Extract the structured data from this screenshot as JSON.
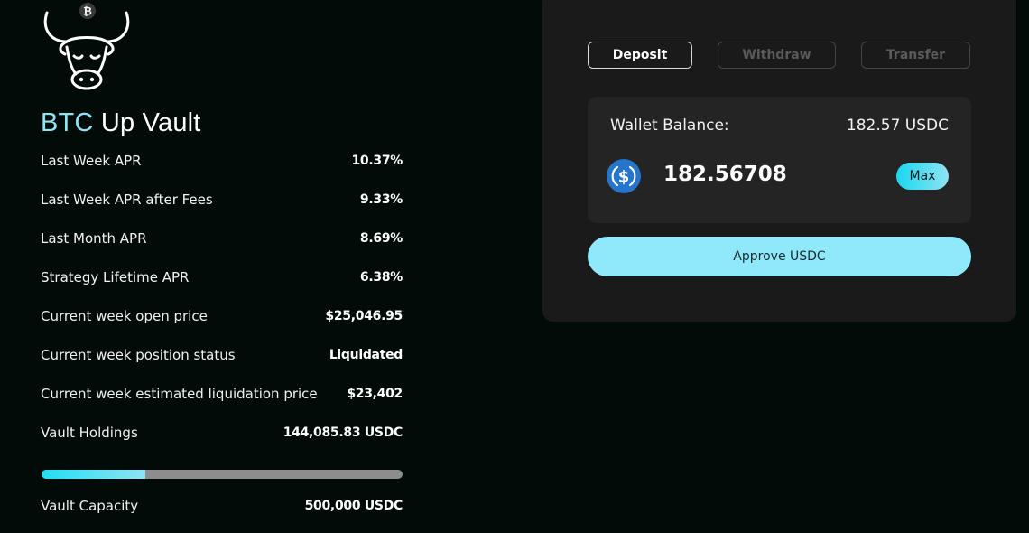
{
  "vault": {
    "title_accent": "BTC",
    "title_rest": "Up Vault",
    "stats": [
      {
        "label": "Last Week APR",
        "value": "10.37%"
      },
      {
        "label": "Last Week APR after Fees",
        "value": "9.33%"
      },
      {
        "label": "Last Month APR",
        "value": "8.69%"
      },
      {
        "label": "Strategy Lifetime APR",
        "value": "6.38%"
      },
      {
        "label": "Current week open price",
        "value": "$25,046.95"
      },
      {
        "label": "Current week position status",
        "value": "Liquidated"
      },
      {
        "label": "Current week estimated liquidation price",
        "value": "$23,402"
      },
      {
        "label": "Vault Holdings",
        "value": "144,085.83 USDC"
      }
    ],
    "capacity": {
      "label": "Vault Capacity",
      "value": "500,000 USDC"
    },
    "fill_fraction": 0.288
  },
  "panel": {
    "tabs": [
      "Deposit",
      "Withdraw",
      "Transfer"
    ],
    "active_tab": 0,
    "wallet_label": "Wallet Balance:",
    "wallet_value": "182.57 USDC",
    "amount": "182.56708",
    "max_label": "Max",
    "approve_label": "Approve USDC"
  },
  "icons": {
    "logo": "bull-head-icon",
    "badge": "bitcoin-icon",
    "token": "usdc-icon"
  },
  "colors": {
    "accent": "#8fe3f3",
    "background": "#010b07",
    "panel": "#1a1a1a"
  }
}
